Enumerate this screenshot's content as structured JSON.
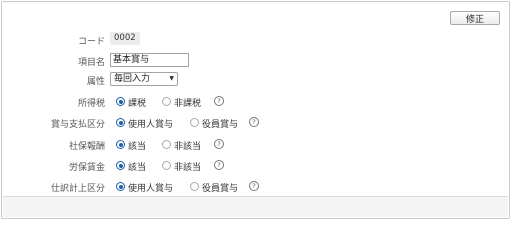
{
  "actions": {
    "edit_label": "修正"
  },
  "fields": {
    "code": {
      "label": "コード",
      "value": "0002"
    },
    "item_name": {
      "label": "項目名",
      "value": "基本賞与"
    },
    "attribute": {
      "label": "属性",
      "selected": "毎回入力"
    },
    "income_tax": {
      "label": "所得税",
      "options": [
        {
          "label": "課税",
          "checked": true
        },
        {
          "label": "非課税",
          "checked": false
        }
      ]
    },
    "bonus_payment_type": {
      "label": "賞与支払区分",
      "options": [
        {
          "label": "使用人賞与",
          "checked": true
        },
        {
          "label": "役員賞与",
          "checked": false
        }
      ]
    },
    "social_insurance_remuneration": {
      "label": "社保報酬",
      "options": [
        {
          "label": "該当",
          "checked": true
        },
        {
          "label": "非該当",
          "checked": false
        }
      ]
    },
    "labor_insurance_wage": {
      "label": "労保賃金",
      "options": [
        {
          "label": "該当",
          "checked": true
        },
        {
          "label": "非該当",
          "checked": false
        }
      ]
    },
    "journal_entry_type": {
      "label": "仕訳計上区分",
      "options": [
        {
          "label": "使用人賞与",
          "checked": true
        },
        {
          "label": "役員賞与",
          "checked": false
        }
      ]
    }
  },
  "icons": {
    "help": "question-circle-icon",
    "dropdown": "triangle-down-icon"
  },
  "colors": {
    "accent": "#1f5fa8",
    "border": "#c9c9c9",
    "footer": "#f4f4f4"
  }
}
